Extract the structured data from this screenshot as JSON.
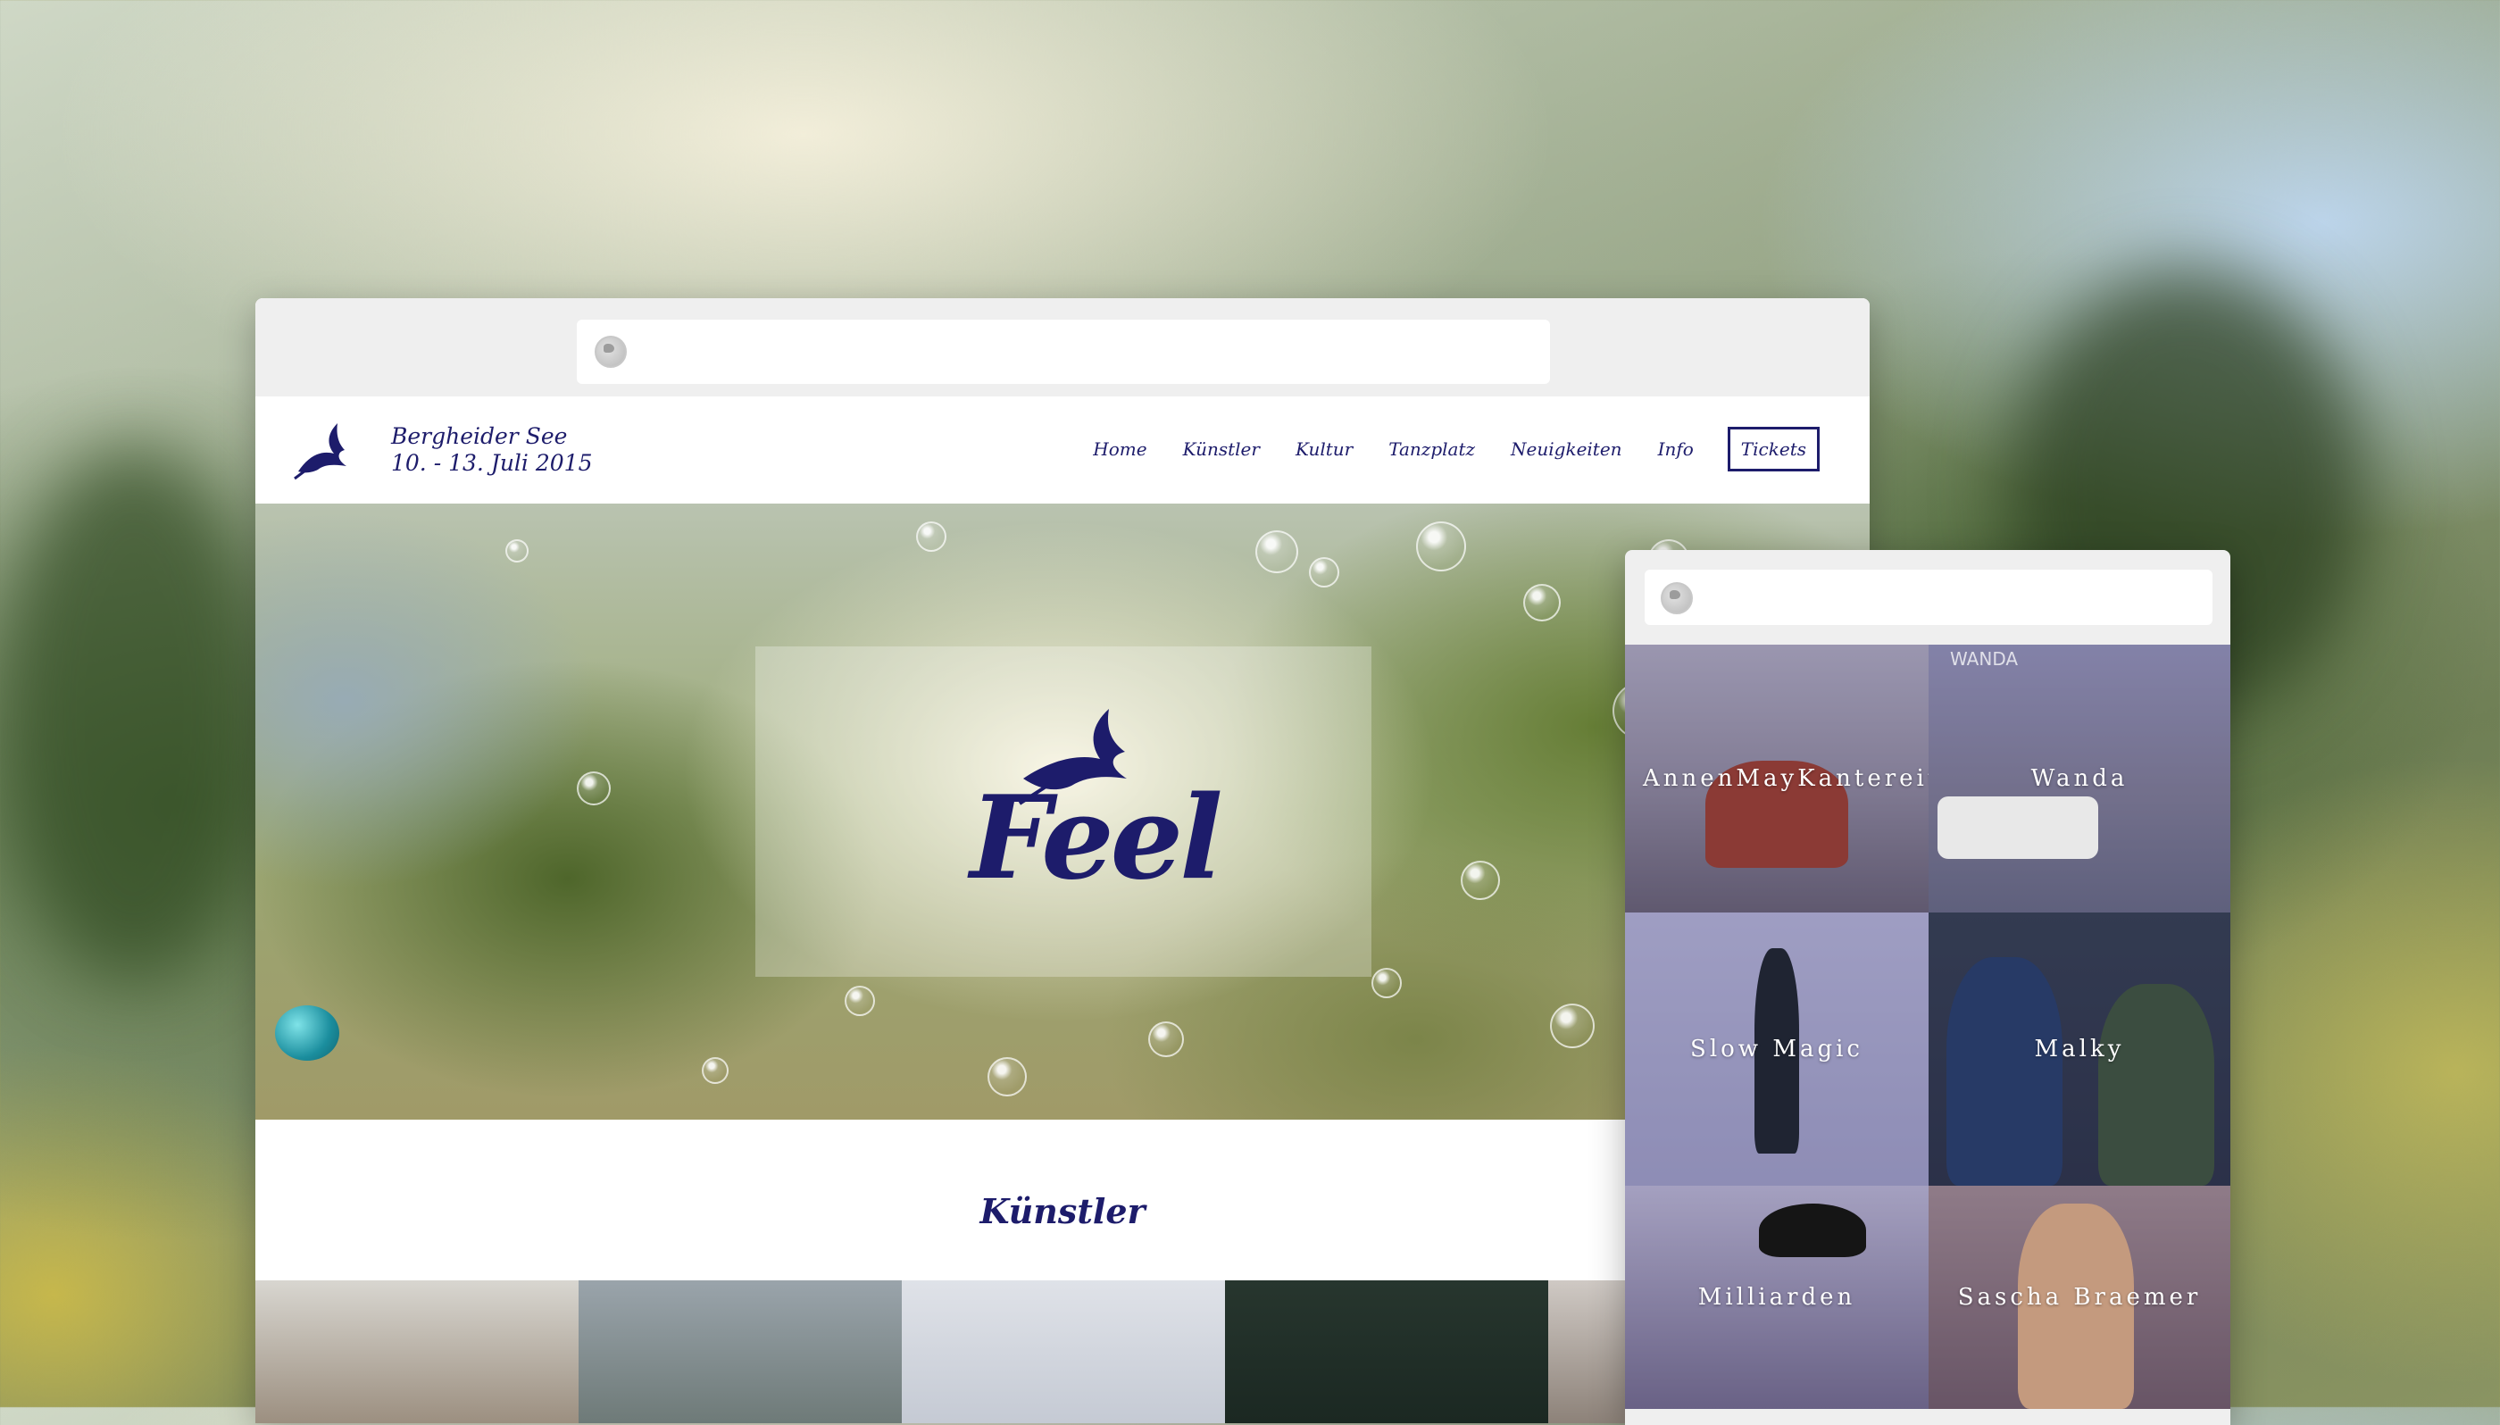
{
  "desktop": {
    "header": {
      "venue_line1": "Bergheider See",
      "venue_line2": "10. - 13. Juli 2015"
    },
    "nav": {
      "items": [
        "Home",
        "Künstler",
        "Kultur",
        "Tanzplatz",
        "Neuigkeiten",
        "Info"
      ],
      "tickets": "Tickets"
    },
    "hero": {
      "title": "Feel"
    },
    "section": {
      "title": "Künstler"
    }
  },
  "mobile": {
    "artists": [
      "AnnenMayKantereit",
      "Wanda",
      "Slow Magic",
      "Malky",
      "Milliarden",
      "Sascha Braemer"
    ],
    "photo_text": "WANDA"
  },
  "colors": {
    "brand": "#1d1c6b",
    "chrome": "#efefef"
  },
  "icons": [
    "globe-icon",
    "swallow-bird-icon",
    "balloon"
  ]
}
